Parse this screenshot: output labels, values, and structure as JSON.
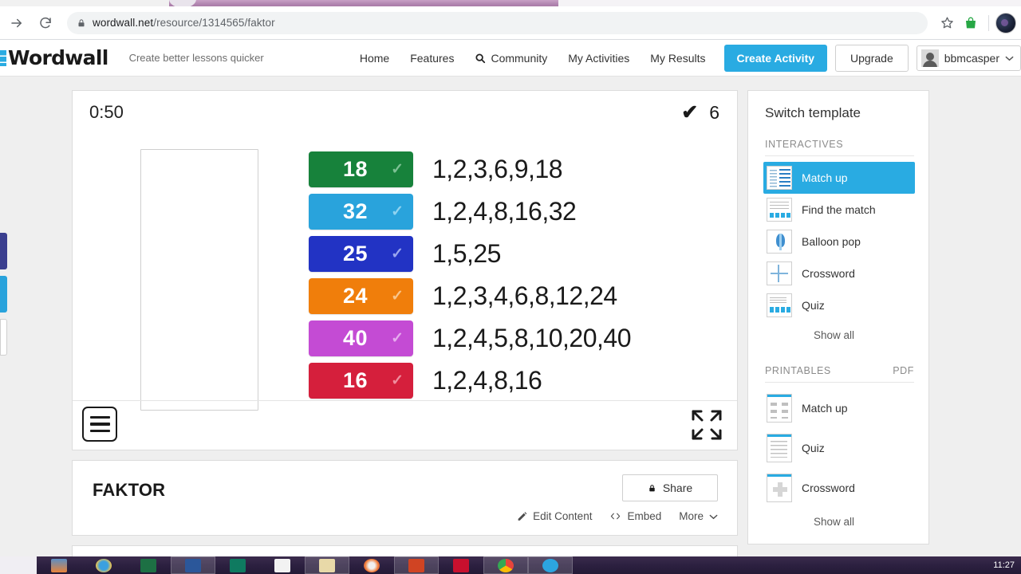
{
  "browser": {
    "url_host": "wordwall.net",
    "url_path": "/resource/1314565/faktor",
    "back_icon": "arrow-right-icon",
    "reload_icon": "reload-icon",
    "lock_icon": "lock-icon",
    "bookmark_icon": "star-icon",
    "extension_icon": "shopping-bag-icon",
    "profile_icon": "profile-avatar-icon"
  },
  "header": {
    "brand": "Wordwall",
    "tagline": "Create better lessons quicker",
    "nav": [
      {
        "label": "Home",
        "icon": ""
      },
      {
        "label": "Features",
        "icon": ""
      },
      {
        "label": "Community",
        "icon": "search-icon"
      },
      {
        "label": "My Activities",
        "icon": ""
      },
      {
        "label": "My Results",
        "icon": ""
      }
    ],
    "create_label": "Create Activity",
    "upgrade_label": "Upgrade",
    "username": "bbmcasper",
    "user_caret": "chevron-down-icon"
  },
  "game": {
    "timer": "0:50",
    "score_check_icon": "check-icon",
    "score": "6",
    "dropzone_label": "",
    "pairs": [
      {
        "number": "18",
        "answer": "1,2,3,6,9,18",
        "color": "#17823b",
        "check": "check-icon"
      },
      {
        "number": "32",
        "answer": "1,2,4,8,16,32",
        "color": "#29a3dc",
        "check": "check-icon"
      },
      {
        "number": "25",
        "answer": "1,5,25",
        "color": "#2233c4",
        "check": "check-icon"
      },
      {
        "number": "24",
        "answer": "1,2,3,4,6,8,12,24",
        "color": "#f07e0b",
        "check": "check-icon"
      },
      {
        "number": "40",
        "answer": "1,2,4,5,8,10,20,40",
        "color": "#c44bd4",
        "check": "check-icon"
      },
      {
        "number": "16",
        "answer": "1,2,4,8,16",
        "color": "#d51f3c",
        "check": "check-icon"
      }
    ],
    "edge_peek_colors": [
      "#3b3f8f",
      "#29a3dc",
      "#ffffff"
    ],
    "menu_icon": "hamburger-menu-icon",
    "fullscreen_icon": "fullscreen-expand-icon"
  },
  "activity": {
    "title": "FAKTOR",
    "share_label": "Share",
    "share_icon": "lock-icon",
    "actions": [
      {
        "label": "Edit Content",
        "icon": "pencil-icon"
      },
      {
        "label": "Embed",
        "icon": "code-icon"
      },
      {
        "label": "More",
        "icon": "chevron-down-icon"
      }
    ]
  },
  "sidebar": {
    "title": "Switch template",
    "interactives": {
      "heading": "INTERACTIVES",
      "items": [
        {
          "label": "Match up",
          "icon": "matchup-thumb-icon",
          "active": true
        },
        {
          "label": "Find the match",
          "icon": "findmatch-thumb-icon",
          "active": false
        },
        {
          "label": "Balloon pop",
          "icon": "balloon-thumb-icon",
          "active": false
        },
        {
          "label": "Crossword",
          "icon": "crossword-thumb-icon",
          "active": false
        },
        {
          "label": "Quiz",
          "icon": "quiz-thumb-icon",
          "active": false
        }
      ],
      "show_all": "Show all"
    },
    "printables": {
      "heading": "PRINTABLES",
      "pdf_label": "PDF",
      "items": [
        {
          "label": "Match up",
          "icon": "printable-matchup-icon"
        },
        {
          "label": "Quiz",
          "icon": "printable-quiz-icon"
        },
        {
          "label": "Crossword",
          "icon": "printable-crossword-icon"
        }
      ],
      "show_all": "Show all"
    }
  },
  "taskbar": {
    "clock": "11:27",
    "items": [
      {
        "name": "explorer-icon",
        "color": "#e8833a"
      },
      {
        "name": "internet-explorer-icon",
        "color": "#3aa0e0"
      },
      {
        "name": "excel-icon",
        "color": "#1d7044"
      },
      {
        "name": "word-icon",
        "color": "#2b579a"
      },
      {
        "name": "publisher-icon",
        "color": "#0f7a60"
      },
      {
        "name": "photos-icon",
        "color": "#f2f2f2"
      },
      {
        "name": "folder-icon",
        "color": "#e8d9a8"
      },
      {
        "name": "firefox-icon",
        "color": "#f0732a"
      },
      {
        "name": "powerpoint-icon",
        "color": "#d04423"
      },
      {
        "name": "mcafee-icon",
        "color": "#c8102e"
      },
      {
        "name": "chrome-icon",
        "color": "#e8453c"
      },
      {
        "name": "telegram-icon",
        "color": "#2ca5e0"
      }
    ]
  }
}
